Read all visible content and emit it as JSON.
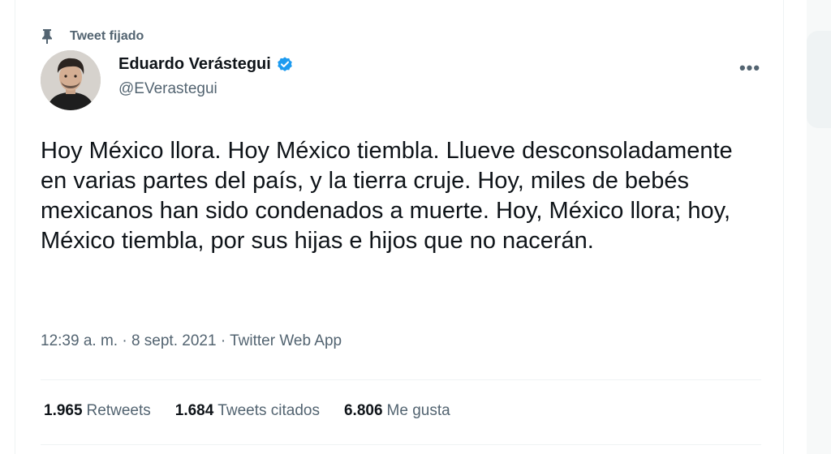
{
  "pinned": {
    "label": "Tweet fijado",
    "icon": "pin-icon"
  },
  "author": {
    "display_name": "Eduardo Verástegui",
    "handle": "@EVerastegui",
    "verified_icon": "verified-badge-icon",
    "verified_color": "#1d9bf0"
  },
  "tweet": {
    "text": "Hoy México llora. Hoy México tiembla. Llueve desconsoladamente en varias partes del país, y la tierra cruje. Hoy, miles de bebés mexicanos han sido condenados a muerte. Hoy, México llora; hoy, México tiembla, por sus hijas e hijos que no nacerán."
  },
  "meta": {
    "time": "12:39 a. m.",
    "separator": " · ",
    "date": "8 sept. 2021",
    "source": "Twitter Web App"
  },
  "stats": [
    {
      "count": "1.965",
      "label": "Retweets"
    },
    {
      "count": "1.684",
      "label": "Tweets citados"
    },
    {
      "count": "6.806",
      "label": "Me gusta"
    }
  ],
  "colors": {
    "text": "#0f1419",
    "secondary": "#536471",
    "divider": "#eff3f4"
  }
}
